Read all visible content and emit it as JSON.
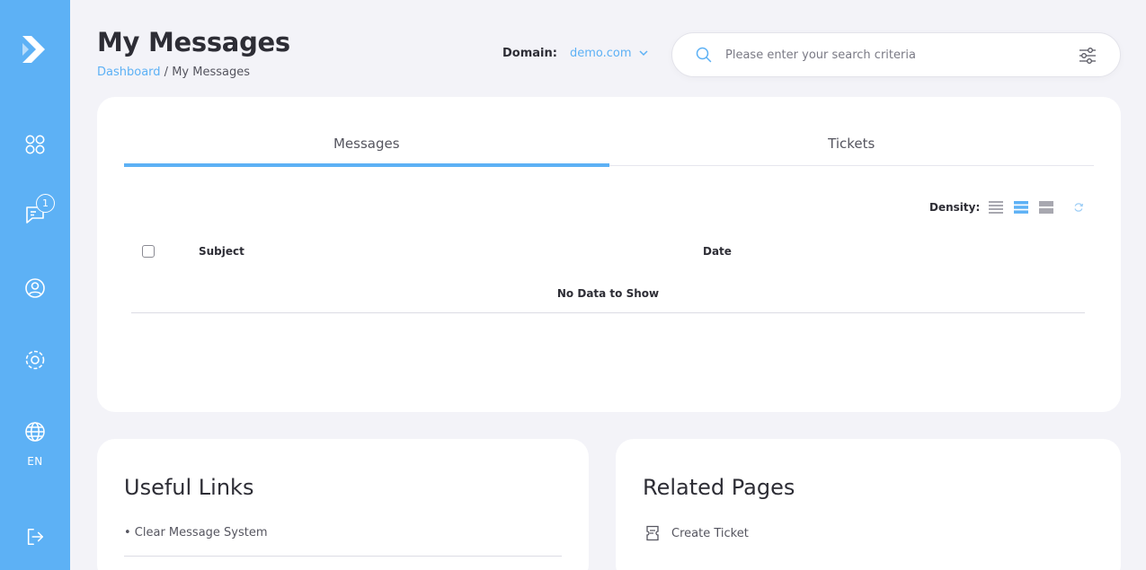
{
  "sidebar": {
    "logo": "logo-arrow-icon",
    "items": [
      {
        "icon": "apps-grid-icon"
      },
      {
        "icon": "messages-icon",
        "badge": "1"
      },
      {
        "icon": "user-profile-icon"
      },
      {
        "icon": "settings-icon"
      },
      {
        "icon": "globe-icon",
        "label": "EN"
      },
      {
        "icon": "logout-icon"
      }
    ]
  },
  "header": {
    "title": "My Messages",
    "breadcrumb": {
      "link": "Dashboard",
      "separator": "/",
      "current": "My Messages"
    },
    "domain": {
      "label": "Domain:",
      "value": "demo.com"
    },
    "search": {
      "placeholder": "Please enter your search criteria"
    }
  },
  "main": {
    "tabs": [
      {
        "label": "Messages",
        "active": true
      },
      {
        "label": "Tickets",
        "active": false
      }
    ],
    "density_label": "Density:",
    "table": {
      "columns": [
        "Subject",
        "Date"
      ],
      "empty_text": "No Data to Show"
    }
  },
  "useful_links": {
    "title": "Useful Links",
    "items": [
      "• Clear Message System"
    ]
  },
  "related_pages": {
    "title": "Related Pages",
    "items": [
      {
        "icon": "ticket-icon",
        "label": "Create Ticket"
      }
    ]
  },
  "colors": {
    "accent": "#5db1f5",
    "background": "#f3f3f8",
    "card": "#ffffff",
    "text": "#2d2d35"
  }
}
